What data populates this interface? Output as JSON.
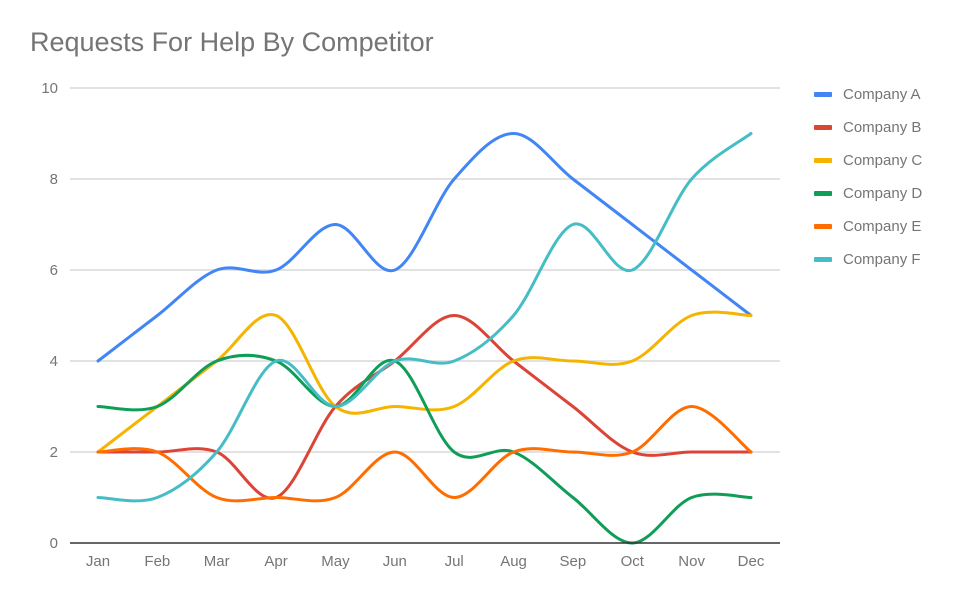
{
  "chart_data": {
    "type": "line",
    "title": "Requests For Help By Competitor",
    "xlabel": "",
    "ylabel": "",
    "categories": [
      "Jan",
      "Feb",
      "Mar",
      "Apr",
      "May",
      "Jun",
      "Jul",
      "Aug",
      "Sep",
      "Oct",
      "Nov",
      "Dec"
    ],
    "ylim": [
      0,
      10
    ],
    "yticks": [
      0,
      2,
      4,
      6,
      8,
      10
    ],
    "grid": true,
    "smooth": true,
    "legend_position": "right",
    "series": [
      {
        "name": "Company A",
        "color": "#4285f4",
        "values": [
          4,
          5,
          6,
          6,
          7,
          6,
          8,
          9,
          8,
          7,
          6,
          5
        ]
      },
      {
        "name": "Company B",
        "color": "#db4437",
        "values": [
          2,
          2,
          2,
          1,
          3,
          4,
          5,
          4,
          3,
          2,
          2,
          2
        ]
      },
      {
        "name": "Company C",
        "color": "#f4b400",
        "values": [
          2,
          3,
          4,
          5,
          3,
          3,
          3,
          4,
          4,
          4,
          5,
          5
        ]
      },
      {
        "name": "Company D",
        "color": "#0f9d58",
        "values": [
          3,
          3,
          4,
          4,
          3,
          4,
          2,
          2,
          1,
          0,
          1,
          1
        ]
      },
      {
        "name": "Company E",
        "color": "#ff6d01",
        "values": [
          2,
          2,
          1,
          1,
          1,
          2,
          1,
          2,
          2,
          2,
          3,
          2
        ]
      },
      {
        "name": "Company F",
        "color": "#46bdc6",
        "values": [
          1,
          1,
          2,
          4,
          3,
          4,
          4,
          5,
          7,
          6,
          8,
          9
        ]
      }
    ]
  }
}
